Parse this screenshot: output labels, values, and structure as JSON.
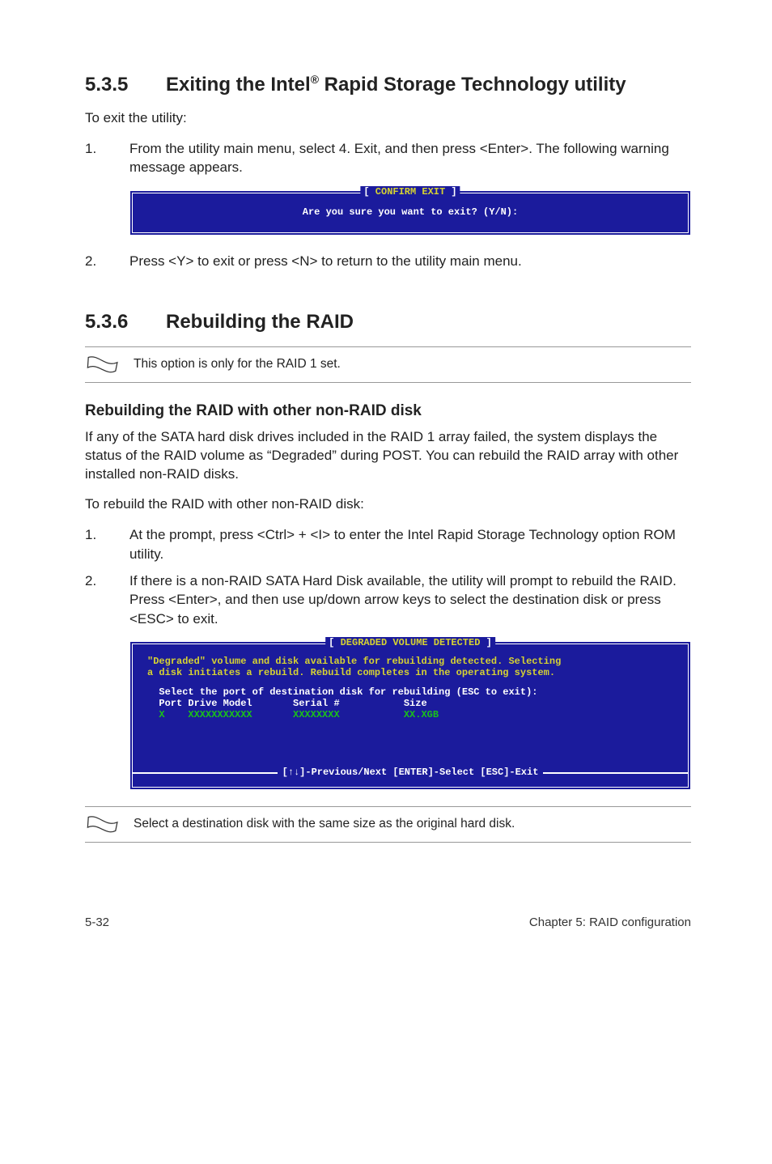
{
  "section535": {
    "number": "5.3.5",
    "title_pre": "Exiting the Intel",
    "title_sup": "®",
    "title_post": " Rapid Storage Technology utility",
    "intro": "To exit the utility:",
    "step1_num": "1.",
    "step1": "From the utility main menu, select 4. Exit, and then press <Enter>. The following warning message appears.",
    "term_title_open": "[ ",
    "term_title": "CONFIRM EXIT",
    "term_title_close": " ]",
    "term_line": "Are you sure you want to exit? (Y/N):",
    "step2_num": "2.",
    "step2": "Press <Y> to exit or press <N> to return to the utility main menu."
  },
  "section536": {
    "number": "5.3.6",
    "title": "Rebuilding the RAID",
    "note1": "This option is only for the RAID 1 set.",
    "subhead": "Rebuilding the RAID with other non-RAID disk",
    "para1": "If any of the SATA hard disk drives included in the RAID 1 array failed, the system displays the status of the RAID volume as “Degraded” during POST. You can rebuild the RAID array with other installed non-RAID disks.",
    "para2": "To rebuild the RAID with other non-RAID disk:",
    "step1_num": "1.",
    "step1": "At the prompt, press <Ctrl> + <I> to enter the Intel Rapid Storage Technology option ROM utility.",
    "step2_num": "2.",
    "step2": "If there is a non-RAID SATA Hard Disk available, the utility will prompt to rebuild the RAID. Press <Enter>, and then use up/down arrow keys to select the destination disk or press <ESC> to exit.",
    "term2": {
      "title_open": "[ ",
      "title": "DEGRADED VOLUME DETECTED",
      "title_close": " ]",
      "line1": "\"Degraded\" volume and disk available for rebuilding detected. Selecting",
      "line2": "a disk initiates a rebuild. Rebuild completes in the operating system.",
      "line3": "  Select the port of destination disk for rebuilding (ESC to exit):",
      "headers": "  Port Drive Model       Serial #           Size",
      "datarow": "  X    XXXXXXXXXXX       XXXXXXXX           XX.XGB",
      "footer": "[↑↓]-Previous/Next  [ENTER]-Select  [ESC]-Exit"
    },
    "note2": "Select a destination disk with the same size as the original hard disk."
  },
  "footer": {
    "left": "5-32",
    "right": "Chapter 5: RAID configuration"
  }
}
